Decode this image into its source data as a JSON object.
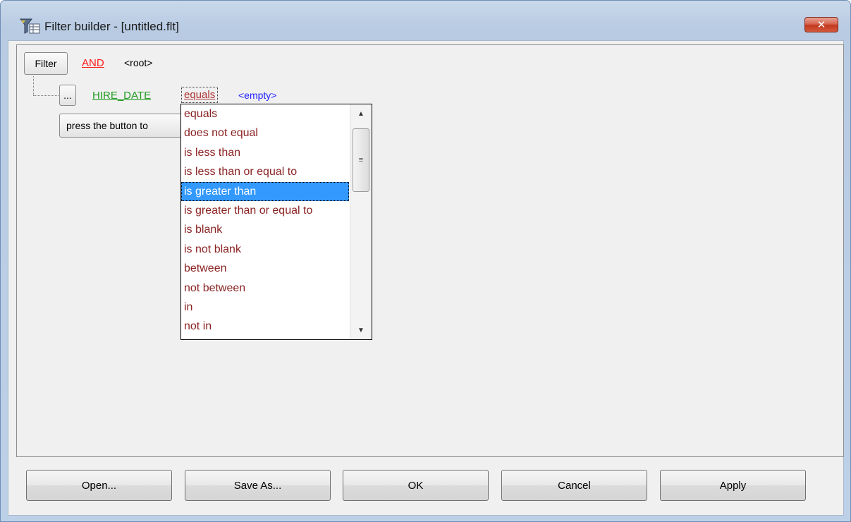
{
  "window": {
    "title": "Filter builder - [untitled.flt]",
    "close_glyph": "✕",
    "icon": "filter-builder-icon"
  },
  "tree": {
    "filter_button": "Filter",
    "group_operator": "AND",
    "root_label": "<root>",
    "condition": {
      "options_button": "...",
      "field": "HIRE_DATE",
      "operator": "equals",
      "value": "<empty>"
    },
    "add_condition_button": "press the button to"
  },
  "operator_dropdown": {
    "selected_index": 4,
    "items": [
      "equals",
      "does not equal",
      "is less than",
      "is less than or equal to",
      "is greater than",
      "is greater than or equal to",
      "is blank",
      "is not blank",
      "between",
      "not between",
      "in",
      "not in"
    ]
  },
  "buttons": {
    "open": "Open...",
    "save_as": "Save As...",
    "ok": "OK",
    "cancel": "Cancel",
    "apply": "Apply"
  },
  "colors": {
    "group_operator": "#ff1a1a",
    "field": "#1f9a1f",
    "operator": "#b03030",
    "value": "#2020ff",
    "selection": "#3399ff"
  }
}
